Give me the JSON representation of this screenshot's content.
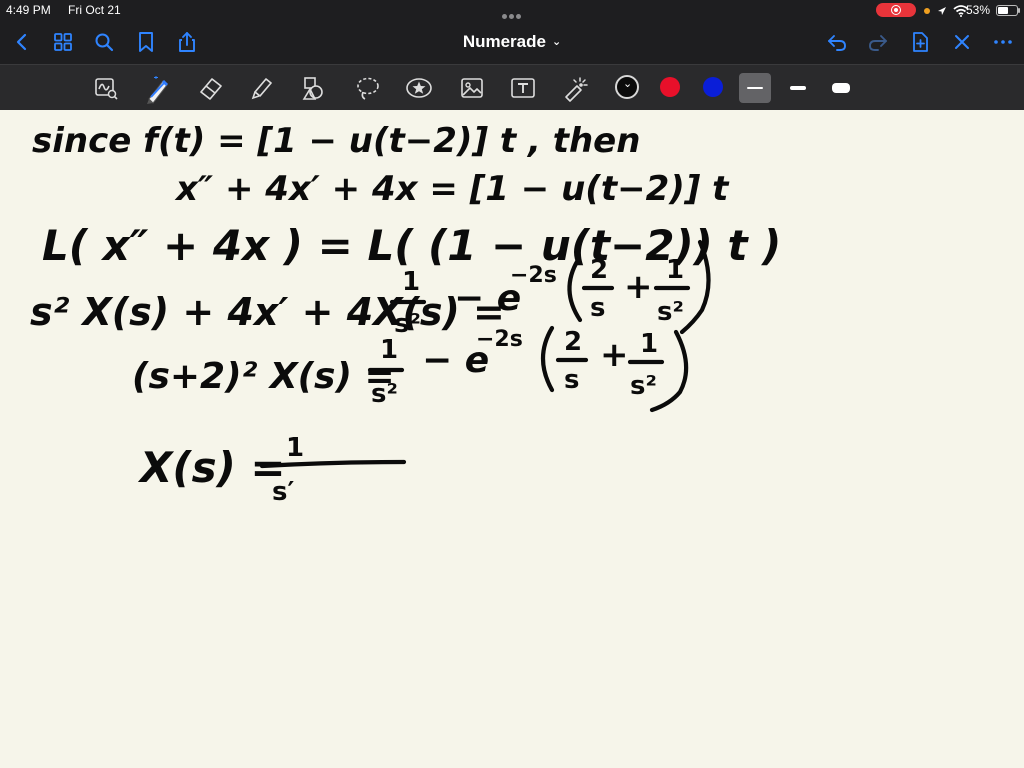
{
  "status_bar": {
    "time": "4:49 PM",
    "date": "Fri Oct 21",
    "battery": "53%"
  },
  "nav": {
    "title": "Numerade",
    "title_chevron": "⌄"
  },
  "toolbar": {
    "tools": [
      "lasso-handwriting",
      "pen",
      "eraser",
      "highlighter",
      "shapes",
      "lasso",
      "sticker",
      "image",
      "text",
      "laser-pointer"
    ],
    "active_tool": "pen",
    "colors": [
      "#0b0b0b",
      "#e8102a",
      "#0a1ed8"
    ],
    "selected_color": "#0b0b0b",
    "active_stroke_size": "thin"
  },
  "handwriting": {
    "line1": "since f(t) = [1 − u(t−2)] t , then",
    "line2": "x″ + 4x′ + 4x = [1 − u(t−2)] t",
    "line3": "L( x″ + 4x ) = L( (1 − u(t−2)) t )",
    "line4_lhs": "s² X(s) + 4x′ + 4X(s) =",
    "line4_frac_num": "1",
    "line4_frac_den": "s²",
    "line4_exp": "− e",
    "line4_sup": "−2s",
    "line4_paren_a_num": "2",
    "line4_paren_a_den": "s",
    "line4_paren_b_num": "1",
    "line4_paren_b_den": "s²",
    "line5_lhs": "(s+2)² X(s) =",
    "line6_lhs": "X(s) =",
    "line6_num": "1",
    "line6_den": "s′"
  }
}
